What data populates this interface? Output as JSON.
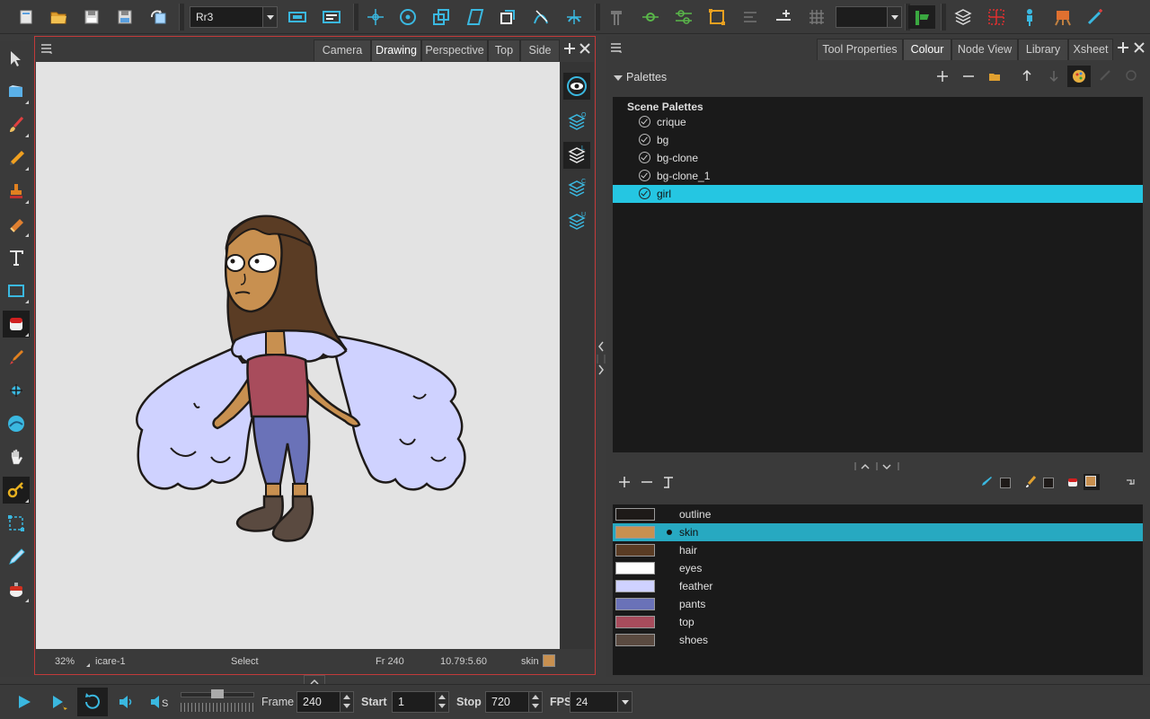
{
  "toolbar": {
    "drawing_combo": "Rr3",
    "icons": [
      "new-scene-icon",
      "open-icon",
      "save-icon",
      "save-as-icon",
      "refresh-icon",
      "transform-icon",
      "pivot-icon",
      "scale-icon",
      "skew-icon",
      "rotate-icon",
      "morph-icon",
      "axis-icon",
      "hammer-icon",
      "peg-icon",
      "deform-icon",
      "bbox-icon",
      "reorder-icon",
      "add-key-icon",
      "grid-icon",
      "colour-picker-icon",
      "layers-icon",
      "select-grid-icon",
      "figure-icon",
      "easel-icon",
      "wand-icon"
    ]
  },
  "left_tools": [
    "select-arrow-icon",
    "contour-editor-icon",
    "brush-icon",
    "pencil-icon",
    "stamp-icon",
    "eraser-icon",
    "text-icon",
    "rectangle-icon",
    "paint-bucket-icon",
    "dropper-icon",
    "pivot-icon",
    "morphing-icon",
    "hand-icon",
    "key-icon",
    "cutter-icon",
    "pen-icon",
    "ink-icon"
  ],
  "view": {
    "tabs": [
      "Camera",
      "Drawing",
      "Perspective",
      "Top",
      "Side"
    ],
    "active_tab": "Drawing",
    "status": {
      "zoom": "32%",
      "drawing": "icare-1",
      "tool": "Select",
      "frame": "Fr 240",
      "coords": "10.79:5.60",
      "colour": "skin"
    },
    "side_buttons": [
      "onion-eye-icon",
      "layer-o-icon",
      "layer-l-icon",
      "layer-c-icon",
      "layer-u-icon"
    ],
    "side_badges": [
      "O",
      "L",
      "C",
      "U"
    ]
  },
  "right": {
    "tabs": [
      "Tool Properties",
      "Colour",
      "Node View",
      "Library",
      "Xsheet"
    ],
    "active_tab": "Colour",
    "palettes_label": "Palettes",
    "scene_palettes_label": "Scene Palettes",
    "palettes": [
      "crique",
      "bg",
      "bg-clone",
      "bg-clone_1",
      "girl"
    ],
    "selected_palette": "girl",
    "colours": [
      {
        "name": "outline",
        "hex": "#1e1a18"
      },
      {
        "name": "skin",
        "hex": "#c89050"
      },
      {
        "name": "hair",
        "hex": "#5a3c24"
      },
      {
        "name": "eyes",
        "hex": "#ffffff"
      },
      {
        "name": "feather",
        "hex": "#cfd2ff"
      },
      {
        "name": "pants",
        "hex": "#6a72b8"
      },
      {
        "name": "top",
        "hex": "#a84c5c"
      },
      {
        "name": "shoes",
        "hex": "#5a4a40"
      }
    ],
    "selected_colour": "skin"
  },
  "playback": {
    "frame_label": "Frame",
    "frame": "240",
    "start_label": "Start",
    "start": "1",
    "stop_label": "Stop",
    "stop": "720",
    "fps_label": "FPS",
    "fps": "24"
  },
  "colors": {
    "accent": "#25c6e2",
    "panel_border": "#c23a3a",
    "canvas": "#e3e3e3"
  }
}
